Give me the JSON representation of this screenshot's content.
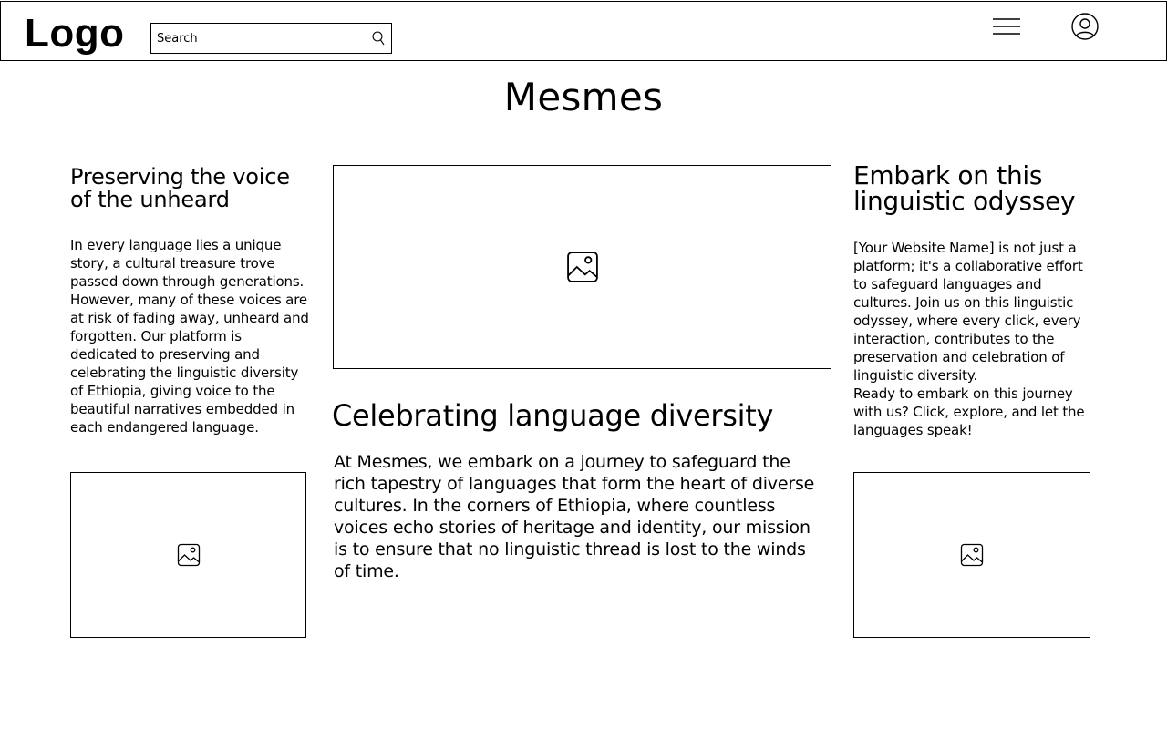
{
  "header": {
    "logo": "Logo",
    "search": {
      "placeholder": "Search"
    },
    "icons": {
      "search": "search-icon",
      "menu": "hamburger-menu-icon",
      "user": "user-profile-icon"
    }
  },
  "site_title": "Mesmes",
  "left_column": {
    "heading": "Preserving the voice of the unheard",
    "body": "In every language lies a unique story, a cultural treasure trove passed down through generations. However, many of these voices are at risk of fading away, unheard and forgotten. Our platform is dedicated to preserving and celebrating the linguistic diversity of Ethiopia, giving voice to the beautiful narratives embedded in each endangered language.",
    "image_icon": "image-placeholder-icon"
  },
  "center_column": {
    "image_icon": "image-placeholder-icon",
    "heading": "Celebrating language diversity",
    "body": "At Mesmes, we embark on a journey to safeguard the rich tapestry of languages that form the heart of diverse cultures. In the corners of Ethiopia, where countless voices echo stories of heritage and identity, our mission is to ensure that no linguistic thread is lost to the winds of time."
  },
  "right_column": {
    "heading": "Embark on this linguistic odyssey",
    "body": "[Your Website Name] is not just a platform; it's a collaborative effort to safeguard languages and cultures. Join us on this linguistic odyssey, where every click, every interaction, contributes to the preservation and celebration of linguistic diversity.",
    "body_2": "Ready to embark on this journey with us? Click, explore, and let the languages speak!",
    "image_icon": "image-placeholder-icon"
  },
  "colors": {
    "border": "#000000",
    "background": "#ffffff",
    "text": "#000000"
  }
}
